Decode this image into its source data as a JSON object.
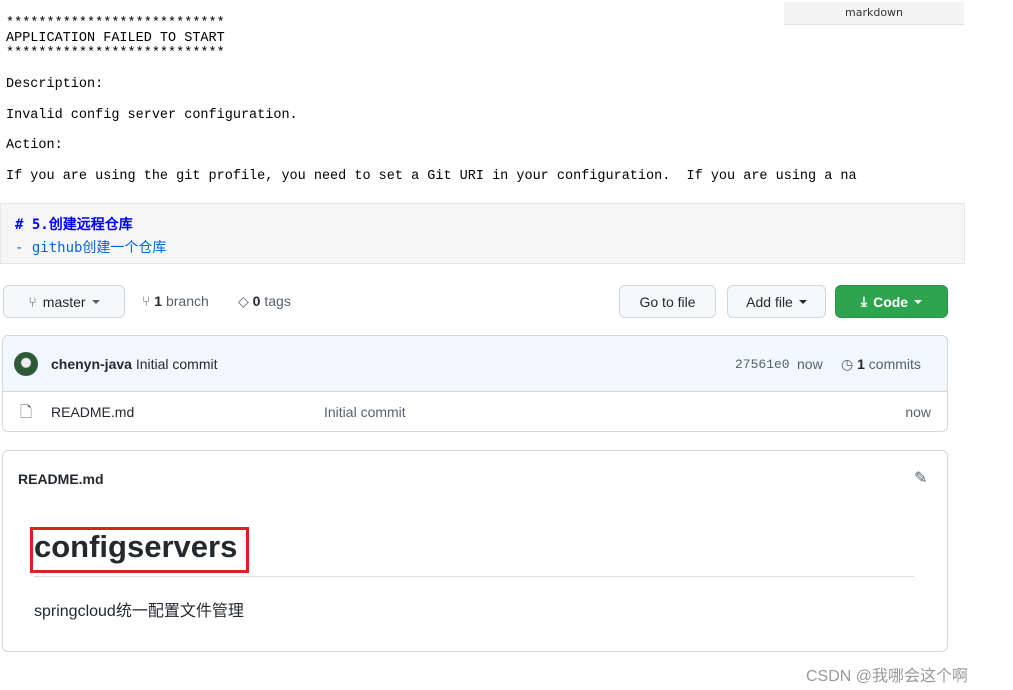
{
  "code_block": {
    "language_label": "markdown",
    "lines": [
      "***************************",
      "APPLICATION FAILED TO START",
      "***************************",
      "Description:",
      "Invalid config server configuration.",
      "Action:",
      "If you are using the git profile, you need to set a Git URI in your configuration.  If you are using a na"
    ]
  },
  "md_block": {
    "heading": "# 5.创建远程仓库",
    "item": "- github创建一个仓库",
    "heading_color": "#0000ff",
    "item_color": "#0366d6"
  },
  "repo": {
    "branch_selector": "master",
    "branch_count": "1",
    "branch_label": "branch",
    "tag_count": "0",
    "tag_label": "tags",
    "go_to_file": "Go to file",
    "add_file": "Add file",
    "code": "Code",
    "code_color": "#2da44e",
    "commit": {
      "author": "chenyn-java",
      "message": "Initial commit",
      "sha": "27561e0",
      "time": "now",
      "count": "1",
      "count_label": "commits"
    },
    "files": [
      {
        "name": "README.md",
        "message": "Initial commit",
        "time": "now"
      }
    ],
    "readme": {
      "title": "README.md",
      "heading": "configservers",
      "body": "springcloud统一配置文件管理",
      "highlight_color": "#e02020"
    }
  },
  "watermark": "CSDN @我哪会这个啊"
}
